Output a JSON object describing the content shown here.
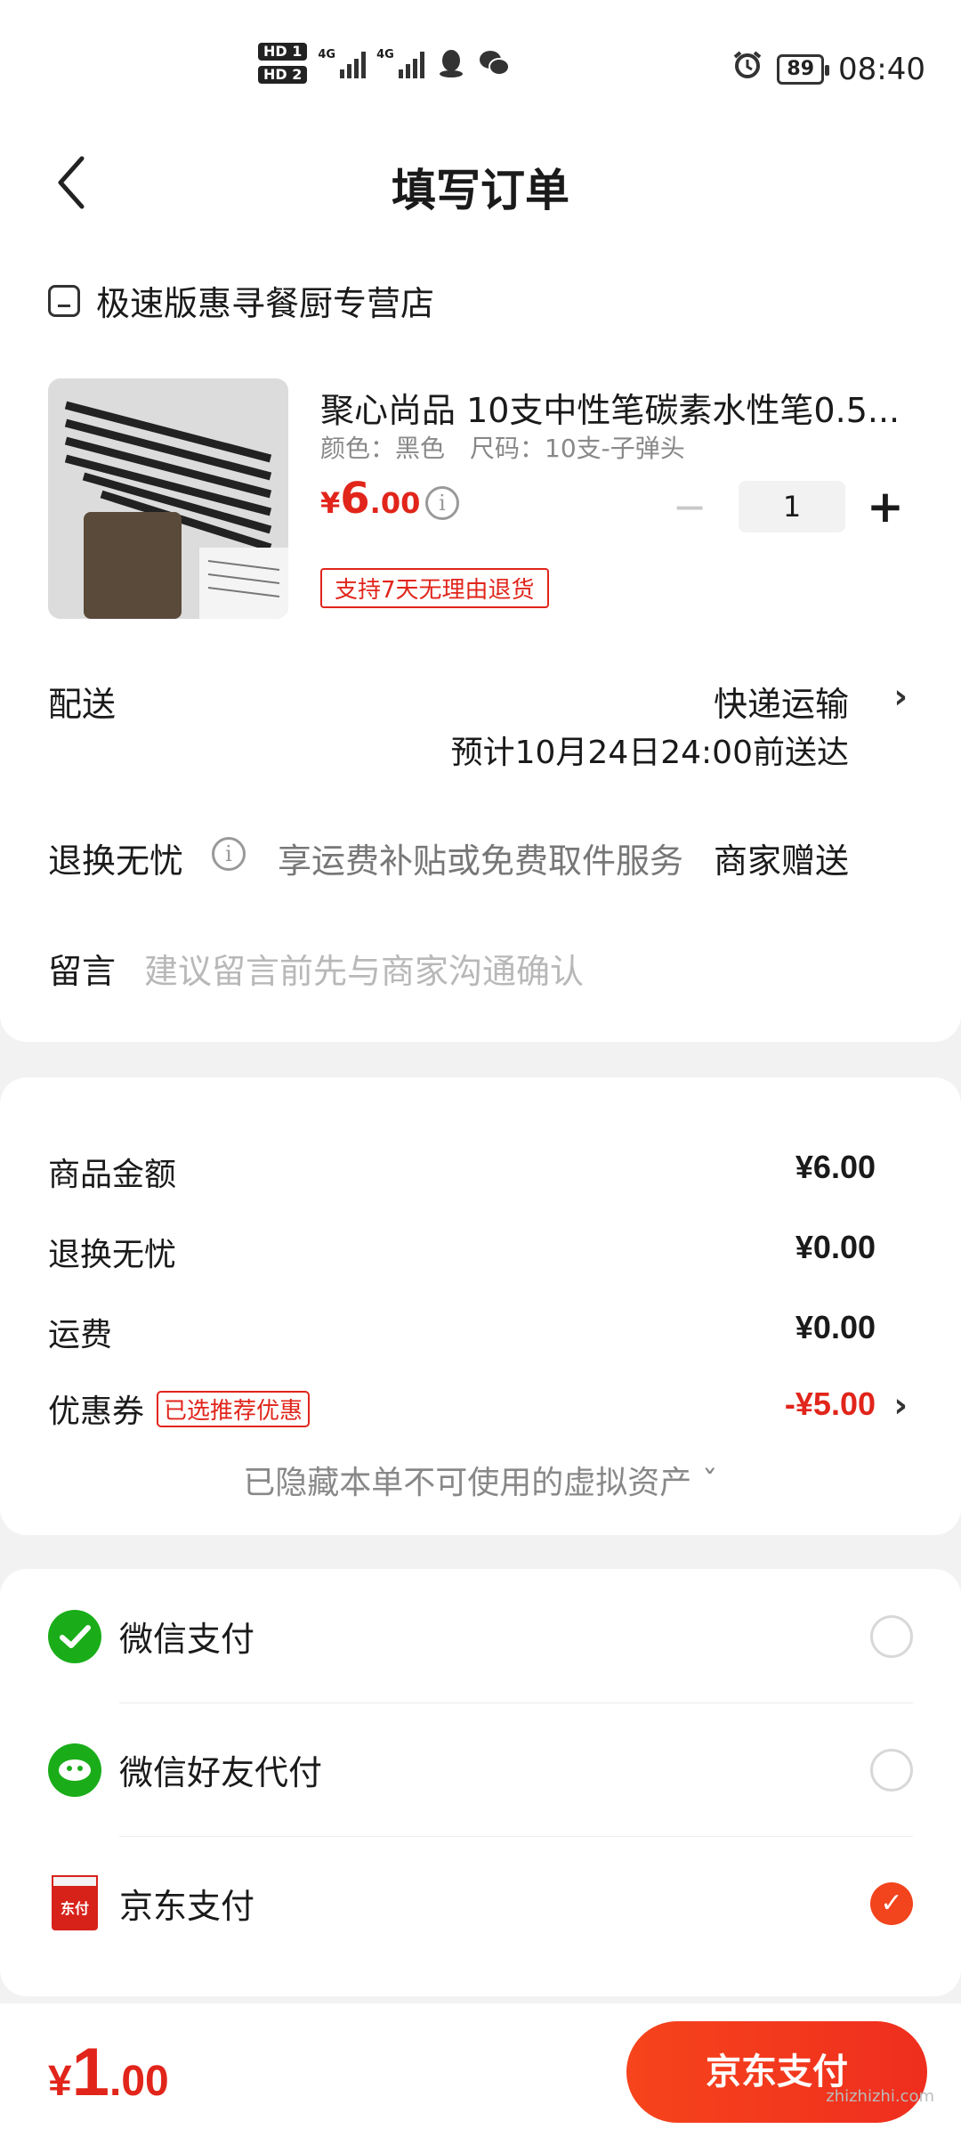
{
  "status_bar": {
    "sim1": "HD 1",
    "sim2": "HD 2",
    "net1": "4G",
    "net2": "4G",
    "battery": "89",
    "time": "08:40",
    "icons": [
      "qq-icon",
      "wechat-icon",
      "alarm-icon"
    ]
  },
  "header": {
    "title": "填写订单"
  },
  "store": {
    "name": "极速版惠寻餐厨专营店"
  },
  "product": {
    "name": "聚心尚品 10支中性笔碳素水性笔0.5...",
    "spec": "颜色：黑色　尺码：10支-子弹头",
    "price_currency": "¥",
    "price_int": "6",
    "price_dec": ".00",
    "quantity": "1",
    "minus": "−",
    "plus": "+",
    "return_policy": "支持7天无理由退货"
  },
  "delivery": {
    "label": "配送",
    "method": "快递运输",
    "eta": "预计10月24日24:00前送达"
  },
  "worry_free": {
    "label": "退换无忧",
    "desc": "享运费补贴或免费取件服务",
    "value": "商家赠送"
  },
  "memo": {
    "label": "留言",
    "placeholder": "建议留言前先与商家沟通确认"
  },
  "fees": {
    "goods_label": "商品金额",
    "goods_value": "¥6.00",
    "worry_label": "退换无忧",
    "worry_value": "¥0.00",
    "freight_label": "运费",
    "freight_value": "¥0.00",
    "coupon_label": "优惠券",
    "coupon_badge": "已选推荐优惠",
    "coupon_value": "-¥5.00",
    "hidden_note": "已隐藏本单不可使用的虚拟资产 ˇ"
  },
  "payment": {
    "methods": [
      {
        "name": "微信支付",
        "selected": false
      },
      {
        "name": "微信好友代付",
        "selected": false
      },
      {
        "name": "京东支付",
        "selected": true
      }
    ],
    "jd_icon_text": "东付"
  },
  "bottom": {
    "currency": "¥",
    "total_int": "1",
    "total_dec": ".00",
    "pay_button": "京东支付",
    "watermark": "zhizhizhi.com"
  },
  "colors": {
    "accent": "#e1251b",
    "wechat": "#1aad19",
    "pay_button": "#f6441c"
  }
}
